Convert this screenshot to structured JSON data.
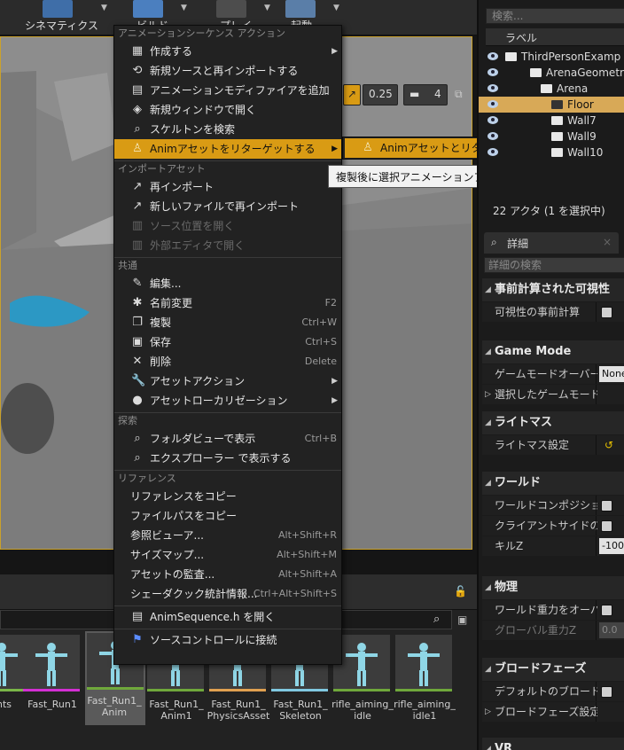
{
  "toolbar": {
    "cinematics_label": "シネマティクス",
    "build_label": "ビルド",
    "play_label": "プレイ",
    "launch_label": "起動"
  },
  "viewport": {
    "snap_value": "0.25",
    "camera_speed": "4"
  },
  "context_menu": {
    "sections": [
      {
        "title": "アニメーションシーケンス アクション",
        "items": [
          {
            "label": "作成する",
            "icon": "create-icon",
            "submenu": true
          },
          {
            "label": "新規ソースと再インポートする",
            "icon": "reimport-source-icon"
          },
          {
            "label": "アニメーションモディファイアを追加",
            "icon": "modifier-icon"
          },
          {
            "label": "新規ウィンドウで開く",
            "icon": "new-window-icon"
          },
          {
            "label": "スケルトンを検索",
            "icon": "find-skeleton-icon"
          },
          {
            "label": "Animアセットをリターゲットする",
            "icon": "retarget-icon",
            "submenu": true,
            "highlight": true
          }
        ]
      },
      {
        "title": "インポートアセット",
        "items": [
          {
            "label": "再インポート",
            "icon": "reimport-icon"
          },
          {
            "label": "新しいファイルで再インポート",
            "icon": "reimport-new-file-icon"
          },
          {
            "label": "ソース位置を開く",
            "icon": "source-location-icon",
            "disabled": true
          },
          {
            "label": "外部エディタで開く",
            "icon": "external-editor-icon",
            "disabled": true
          }
        ]
      },
      {
        "title": "共通",
        "items": [
          {
            "label": "編集...",
            "icon": "edit-icon"
          },
          {
            "label": "名前変更",
            "icon": "rename-icon",
            "shortcut": "F2"
          },
          {
            "label": "複製",
            "icon": "duplicate-icon",
            "shortcut": "Ctrl+W"
          },
          {
            "label": "保存",
            "icon": "save-icon",
            "shortcut": "Ctrl+S"
          },
          {
            "label": "削除",
            "icon": "delete-icon",
            "shortcut": "Delete"
          },
          {
            "label": "アセットアクション",
            "icon": "wrench-icon",
            "submenu": true
          },
          {
            "label": "アセットローカリゼーション",
            "icon": "globe-icon",
            "submenu": true
          }
        ]
      },
      {
        "title": "探索",
        "items": [
          {
            "label": "フォルダビューで表示",
            "icon": "folder-search-icon",
            "shortcut": "Ctrl+B"
          },
          {
            "label": "エクスプローラー で表示する",
            "icon": "explorer-search-icon"
          }
        ]
      },
      {
        "title": "リファレンス",
        "items": [
          {
            "label": "リファレンスをコピー"
          },
          {
            "label": "ファイルパスをコピー"
          },
          {
            "label": "参照ビューア...",
            "shortcut": "Alt+Shift+R"
          },
          {
            "label": "サイズマップ...",
            "shortcut": "Alt+Shift+M"
          },
          {
            "label": "アセットの監査...",
            "shortcut": "Alt+Shift+A"
          },
          {
            "label": "シェーダクック統計情報...",
            "shortcut": "Ctrl+Alt+Shift+S"
          }
        ]
      }
    ],
    "open_anim_sequence": "AnimSequence.h を開く",
    "connect_source_control": "ソースコントロールに接続"
  },
  "submenu": {
    "item_label": "Animアセットとリターゲットを複製する"
  },
  "tooltip": {
    "text": "複製後に選択アニメーションアセットを新規スケルトンにリターゲットし"
  },
  "content_browser": {
    "assets": [
      {
        "name": "ints",
        "bar_color": "#7ab648"
      },
      {
        "name": "Fast_Run1",
        "bar_color": "#d32fd3"
      },
      {
        "name": "Fast_Run1_\nAnim",
        "bar_color": "#6fa83b",
        "selected": true
      },
      {
        "name": "Fast_Run1_\nAnim1",
        "bar_color": "#6fa83b"
      },
      {
        "name": "Fast_Run1_\nPhysicsAsset",
        "bar_color": "#e0a050"
      },
      {
        "name": "Fast_Run1_\nSkeleton",
        "bar_color": "#80c8e0"
      },
      {
        "name": "rifle_aiming_\nidle",
        "bar_color": "#6fa83b"
      },
      {
        "name": "rifle_aiming_\nidle1",
        "bar_color": "#6fa83b"
      }
    ]
  },
  "outliner": {
    "search_placeholder": "検索...",
    "column_label": "ラベル",
    "rows": [
      {
        "label": "ThirdPersonExamp",
        "indent": 48
      },
      {
        "label": "ArenaGeometry",
        "indent": 76
      },
      {
        "label": "Arena",
        "indent": 88
      },
      {
        "label": "Floor",
        "indent": 100,
        "selected": true
      },
      {
        "label": "Wall7",
        "indent": 100
      },
      {
        "label": "Wall9",
        "indent": 100
      },
      {
        "label": "Wall10",
        "indent": 100
      }
    ],
    "actor_count": "22 アクタ (1 を選択中)"
  },
  "details": {
    "tab_label": "詳細",
    "search_placeholder": "詳細の検索",
    "sections": [
      {
        "title": "事前計算された可視性",
        "rows": [
          {
            "label": "可視性の事前計算",
            "type": "checkbox"
          }
        ]
      },
      {
        "title": "Game Mode",
        "rows": [
          {
            "label": "ゲームモードオーバーラ",
            "type": "value",
            "value": "None"
          },
          {
            "label": "選択したゲームモード",
            "type": "expand"
          }
        ]
      },
      {
        "title": "ライトマス",
        "rows": [
          {
            "label": "ライトマス設定",
            "type": "reset"
          }
        ]
      },
      {
        "title": "ワールド",
        "rows": [
          {
            "label": "ワールドコンポジション",
            "type": "checkbox"
          },
          {
            "label": "クライアントサイドのレベ",
            "type": "checkbox"
          },
          {
            "label": "キルZ",
            "type": "value",
            "value": "-1000"
          }
        ]
      },
      {
        "title": "物理",
        "rows": [
          {
            "label": "ワールド重力をオーバー",
            "type": "checkbox"
          },
          {
            "label": "グローバル重力Z",
            "type": "value",
            "value": "0.0",
            "disabled": true
          }
        ]
      },
      {
        "title": "ブロードフェーズ",
        "rows": [
          {
            "label": "デフォルトのブロードフェ",
            "type": "checkbox"
          },
          {
            "label": "ブロードフェーズ設定",
            "type": "expand"
          }
        ]
      },
      {
        "title": "VR",
        "rows": []
      }
    ]
  },
  "colors": {
    "highlight": "#d99b14",
    "selected_row": "#d8a957",
    "viewport_border": "#caa12b"
  }
}
